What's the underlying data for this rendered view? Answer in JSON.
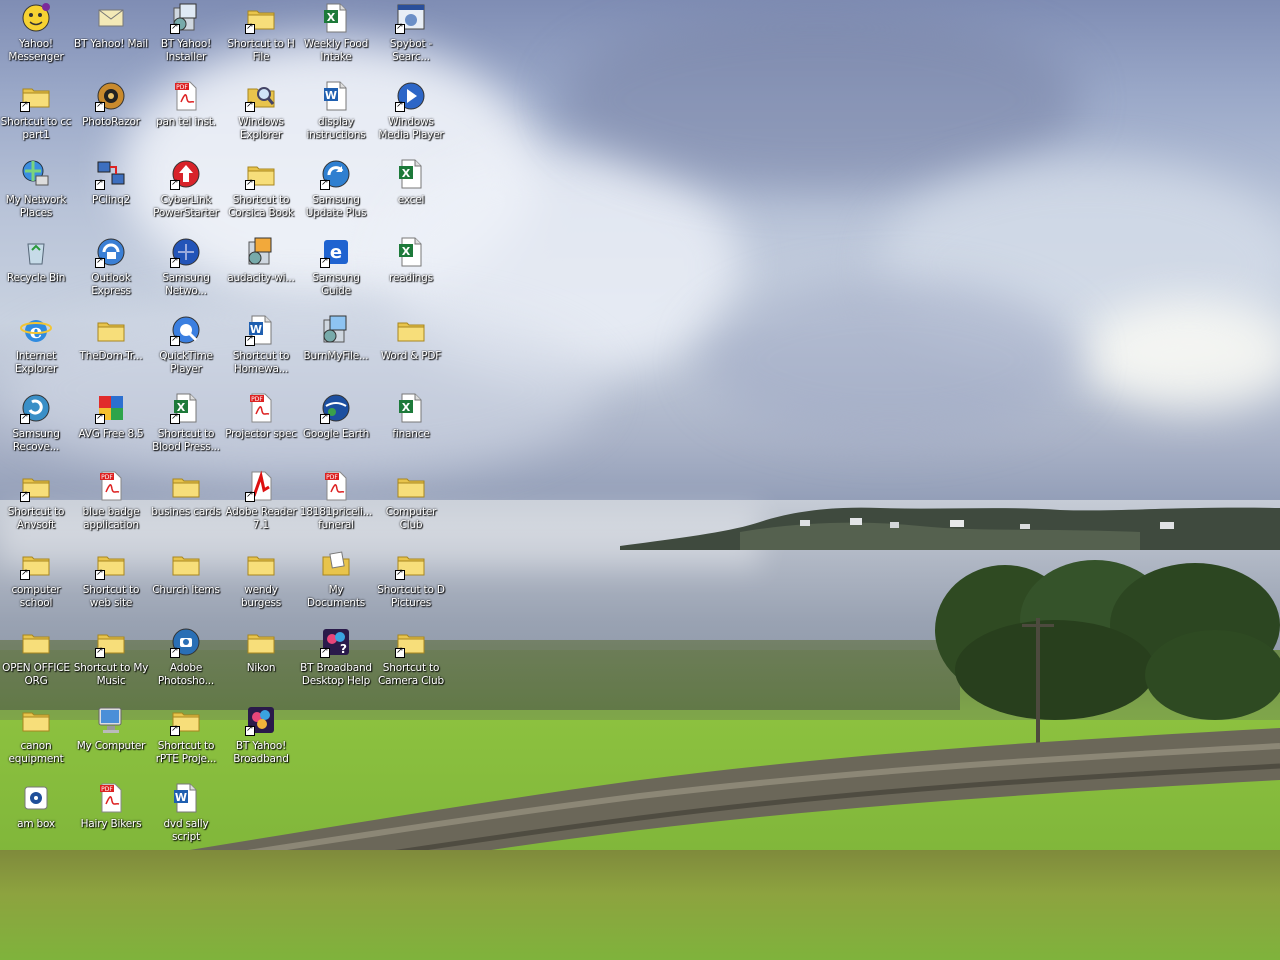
{
  "desktop": {
    "columns": [
      [
        {
          "label": "Yahoo!\nMessenger",
          "icon": "yahoo-messenger-icon",
          "shortcut": false
        },
        {
          "label": "Shortcut to cc\npart1",
          "icon": "folder-icon",
          "shortcut": true
        },
        {
          "label": "My Network\nPlaces",
          "icon": "network-places-icon",
          "shortcut": false
        },
        {
          "label": "Recycle Bin",
          "icon": "recycle-bin-icon",
          "shortcut": false
        },
        {
          "label": "Internet\nExplorer",
          "icon": "internet-explorer-icon",
          "shortcut": false
        },
        {
          "label": "Samsung\nRecove...",
          "icon": "samsung-recovery-icon",
          "shortcut": true
        },
        {
          "label": "Shortcut to\nAnvsoft",
          "icon": "folder-icon",
          "shortcut": true
        },
        {
          "label": "computer\nschool",
          "icon": "folder-icon",
          "shortcut": true
        },
        {
          "label": "OPEN OFFICE\nORG",
          "icon": "folder-icon",
          "shortcut": false
        },
        {
          "label": "canon\nequipment",
          "icon": "folder-icon",
          "shortcut": false
        },
        {
          "label": "am box",
          "icon": "am-box-icon",
          "shortcut": false
        }
      ],
      [
        {
          "label": "BT Yahoo! Mail",
          "icon": "mail-icon",
          "shortcut": false
        },
        {
          "label": "PhotoRazor",
          "icon": "photorazor-icon",
          "shortcut": true
        },
        {
          "label": "PClinq2",
          "icon": "pclinq-icon",
          "shortcut": true
        },
        {
          "label": "Outlook\nExpress",
          "icon": "outlook-express-icon",
          "shortcut": true
        },
        {
          "label": "TheDom-Tr...",
          "icon": "folder-icon",
          "shortcut": false
        },
        {
          "label": "AVG Free 8.5",
          "icon": "avg-icon",
          "shortcut": true
        },
        {
          "label": "blue badge\napplication",
          "icon": "pdf-icon",
          "shortcut": false
        },
        {
          "label": "Shortcut to\nweb site",
          "icon": "folder-icon",
          "shortcut": true
        },
        {
          "label": "Shortcut to My\nMusic",
          "icon": "music-folder-icon",
          "shortcut": true
        },
        {
          "label": "My Computer",
          "icon": "my-computer-icon",
          "shortcut": false
        },
        {
          "label": "Hairy Bikers",
          "icon": "pdf-icon",
          "shortcut": false
        }
      ],
      [
        {
          "label": "BT Yahoo!\nInstaller",
          "icon": "installer-icon",
          "shortcut": true
        },
        {
          "label": "pan tel inst.",
          "icon": "pdf-icon",
          "shortcut": false
        },
        {
          "label": "CyberLink\nPowerStarter",
          "icon": "cyberlink-icon",
          "shortcut": true
        },
        {
          "label": "Samsung\nNetwo...",
          "icon": "samsung-network-icon",
          "shortcut": true
        },
        {
          "label": "QuickTime\nPlayer",
          "icon": "quicktime-icon",
          "shortcut": true
        },
        {
          "label": "Shortcut to\nBlood Press...",
          "icon": "excel-doc-icon",
          "shortcut": true
        },
        {
          "label": "busines cards",
          "icon": "folder-icon",
          "shortcut": false
        },
        {
          "label": "Church Items",
          "icon": "folder-icon",
          "shortcut": false
        },
        {
          "label": "Adobe\nPhotosho...",
          "icon": "photoshop-icon",
          "shortcut": true
        },
        {
          "label": "Shortcut to\nrPTE Proje...",
          "icon": "folder-icon",
          "shortcut": true
        },
        {
          "label": "dvd sally script",
          "icon": "word-doc-icon",
          "shortcut": false
        }
      ],
      [
        {
          "label": "Shortcut to H\nFile",
          "icon": "folder-icon",
          "shortcut": true
        },
        {
          "label": "Windows\nExplorer",
          "icon": "windows-explorer-icon",
          "shortcut": true
        },
        {
          "label": "Shortcut to\nCorsica Book",
          "icon": "folder-icon",
          "shortcut": true
        },
        {
          "label": "audacity-wi...",
          "icon": "audacity-installer-icon",
          "shortcut": false
        },
        {
          "label": "Shortcut to\nHomewa...",
          "icon": "word-doc-icon",
          "shortcut": true
        },
        {
          "label": "Projector spec",
          "icon": "pdf-icon",
          "shortcut": false
        },
        {
          "label": "Adobe Reader\n7.1",
          "icon": "adobe-reader-icon",
          "shortcut": true
        },
        {
          "label": "wendy\nburgess",
          "icon": "folder-icon",
          "shortcut": false
        },
        {
          "label": "Nikon",
          "icon": "folder-icon",
          "shortcut": false
        },
        {
          "label": "BT Yahoo!\nBroadband",
          "icon": "bt-broadband-icon",
          "shortcut": true
        }
      ],
      [
        {
          "label": "Weekly Food\nIntake",
          "icon": "excel-doc-icon",
          "shortcut": false
        },
        {
          "label": "display\ninstructions",
          "icon": "word-doc-icon",
          "shortcut": false
        },
        {
          "label": "Samsung\nUpdate Plus",
          "icon": "samsung-update-icon",
          "shortcut": true
        },
        {
          "label": "Samsung\nGuide",
          "icon": "samsung-guide-icon",
          "shortcut": true
        },
        {
          "label": "BurnMyFile...",
          "icon": "burn-installer-icon",
          "shortcut": false
        },
        {
          "label": "Google Earth",
          "icon": "google-earth-icon",
          "shortcut": true
        },
        {
          "label": "18181priceli...\nfuneral",
          "icon": "pdf-icon",
          "shortcut": false
        },
        {
          "label": "My Documents",
          "icon": "my-documents-icon",
          "shortcut": false
        },
        {
          "label": "BT Broadband\nDesktop Help",
          "icon": "bt-help-icon",
          "shortcut": true
        }
      ],
      [
        {
          "label": "Spybot -\nSearc...",
          "icon": "spybot-icon",
          "shortcut": true
        },
        {
          "label": "Windows\nMedia Player",
          "icon": "media-player-icon",
          "shortcut": true
        },
        {
          "label": "excel",
          "icon": "excel-doc-icon",
          "shortcut": false
        },
        {
          "label": "readings",
          "icon": "excel-doc-icon",
          "shortcut": false
        },
        {
          "label": "Word & PDF",
          "icon": "folder-icon",
          "shortcut": false
        },
        {
          "label": "finance",
          "icon": "excel-doc-icon",
          "shortcut": false
        },
        {
          "label": "Computer Club",
          "icon": "folder-icon",
          "shortcut": false
        },
        {
          "label": "Shortcut to D\nPictures",
          "icon": "folder-icon",
          "shortcut": true
        },
        {
          "label": "Shortcut to\nCamera Club",
          "icon": "folder-icon",
          "shortcut": true
        }
      ]
    ]
  }
}
